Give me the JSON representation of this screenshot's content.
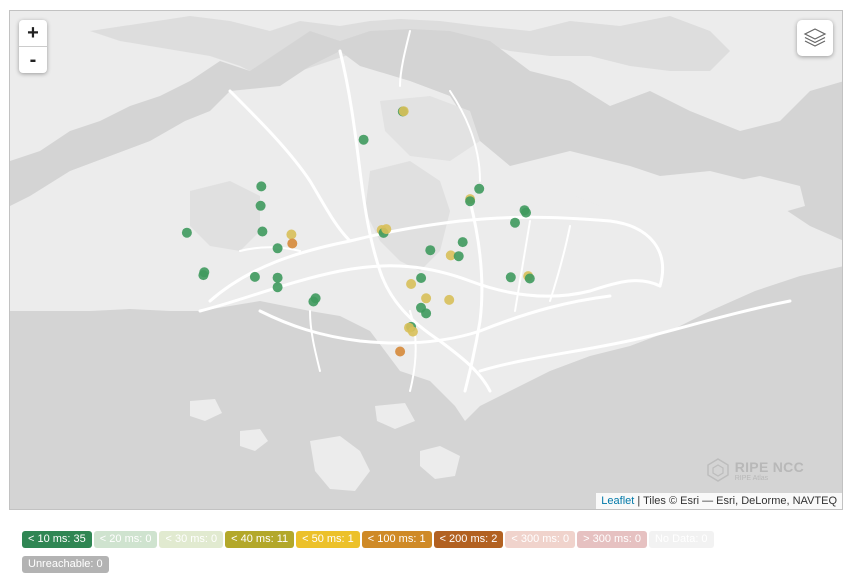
{
  "map": {
    "zoom_in_label": "+",
    "zoom_out_label": "-",
    "layers_icon": "layers-icon",
    "attribution": {
      "link": "Leaflet",
      "text": " | Tiles © Esri — Esri, DeLorme, NAVTEQ"
    },
    "brand": {
      "name": "RIPE NCC",
      "sub": "RIPE Atlas"
    }
  },
  "colors": {
    "water": "#d4d4d4",
    "land": "#ececec",
    "park": "#e2e2e2",
    "road": "#ffffff",
    "green": "#3f9a5e",
    "yellow": "#d8c05a",
    "orange": "#d68a3a"
  },
  "probes": [
    {
      "lat": 1.4487,
      "lon": 103.8213,
      "cat": "green"
    },
    {
      "lat": 1.4309,
      "lon": 103.7999,
      "cat": "green"
    },
    {
      "lat": 1.4489,
      "lon": 103.8218,
      "cat": "yellow"
    },
    {
      "lat": 1.4015,
      "lon": 103.7441,
      "cat": "green"
    },
    {
      "lat": 1.3893,
      "lon": 103.7437,
      "cat": "green"
    },
    {
      "lat": 1.3723,
      "lon": 103.7035,
      "cat": "green"
    },
    {
      "lat": 1.3731,
      "lon": 103.7447,
      "cat": "green"
    },
    {
      "lat": 1.3712,
      "lon": 103.7605,
      "cat": "yellow"
    },
    {
      "lat": 1.3655,
      "lon": 103.761,
      "cat": "orange"
    },
    {
      "lat": 1.3625,
      "lon": 103.753,
      "cat": "green"
    },
    {
      "lat": 1.3474,
      "lon": 103.713,
      "cat": "green"
    },
    {
      "lat": 1.3456,
      "lon": 103.7125,
      "cat": "green"
    },
    {
      "lat": 1.3445,
      "lon": 103.7406,
      "cat": "green"
    },
    {
      "lat": 1.344,
      "lon": 103.753,
      "cat": "green"
    },
    {
      "lat": 1.338,
      "lon": 103.753,
      "cat": "green"
    },
    {
      "lat": 1.331,
      "lon": 103.7737,
      "cat": "green"
    },
    {
      "lat": 1.329,
      "lon": 103.7725,
      "cat": "green"
    },
    {
      "lat": 1.374,
      "lon": 103.8098,
      "cat": "yellow"
    },
    {
      "lat": 1.3722,
      "lon": 103.8108,
      "cat": "green"
    },
    {
      "lat": 1.3746,
      "lon": 103.8123,
      "cat": "yellow"
    },
    {
      "lat": 1.4,
      "lon": 103.863,
      "cat": "green"
    },
    {
      "lat": 1.3935,
      "lon": 103.858,
      "cat": "yellow"
    },
    {
      "lat": 1.3922,
      "lon": 103.858,
      "cat": "green"
    },
    {
      "lat": 1.3664,
      "lon": 103.854,
      "cat": "green"
    },
    {
      "lat": 1.358,
      "lon": 103.8475,
      "cat": "yellow"
    },
    {
      "lat": 1.3575,
      "lon": 103.8518,
      "cat": "green"
    },
    {
      "lat": 1.3613,
      "lon": 103.8363,
      "cat": "green"
    },
    {
      "lat": 1.3438,
      "lon": 103.8313,
      "cat": "green"
    },
    {
      "lat": 1.34,
      "lon": 103.8258,
      "cat": "yellow"
    },
    {
      "lat": 1.331,
      "lon": 103.834,
      "cat": "yellow"
    },
    {
      "lat": 1.33,
      "lon": 103.8466,
      "cat": "yellow"
    },
    {
      "lat": 1.325,
      "lon": 103.8312,
      "cat": "green"
    },
    {
      "lat": 1.3215,
      "lon": 103.834,
      "cat": "green"
    },
    {
      "lat": 1.313,
      "lon": 103.8258,
      "cat": "green"
    },
    {
      "lat": 1.3125,
      "lon": 103.8247,
      "cat": "yellow"
    },
    {
      "lat": 1.31,
      "lon": 103.8268,
      "cat": "yellow"
    },
    {
      "lat": 1.2975,
      "lon": 103.8198,
      "cat": "orange"
    },
    {
      "lat": 1.385,
      "lon": 103.8885,
      "cat": "green"
    },
    {
      "lat": 1.3865,
      "lon": 103.8877,
      "cat": "green"
    },
    {
      "lat": 1.3786,
      "lon": 103.8825,
      "cat": "green"
    },
    {
      "lat": 1.3442,
      "lon": 103.8802,
      "cat": "green"
    },
    {
      "lat": 1.345,
      "lon": 103.8897,
      "cat": "yellow"
    },
    {
      "lat": 1.3435,
      "lon": 103.8906,
      "cat": "green"
    }
  ],
  "legend": [
    {
      "label": "< 10 ms: 35",
      "bg": "#2f8653",
      "fg": "#ffffff"
    },
    {
      "label": "< 20 ms: 0",
      "bg": "#cfe3cf",
      "fg": "#ffffff"
    },
    {
      "label": "< 30 ms: 0",
      "bg": "#e1ead0",
      "fg": "#ffffff"
    },
    {
      "label": "< 40 ms: 11",
      "bg": "#b3a82a",
      "fg": "#ffffff"
    },
    {
      "label": "< 50 ms: 1",
      "bg": "#ecc12a",
      "fg": "#ffffff"
    },
    {
      "label": "< 100 ms: 1",
      "bg": "#cf8a27",
      "fg": "#ffffff"
    },
    {
      "label": "< 200 ms: 2",
      "bg": "#b26121",
      "fg": "#ffffff"
    },
    {
      "label": "< 300 ms: 0",
      "bg": "#f0d3cc",
      "fg": "#ffffff"
    },
    {
      "label": "> 300 ms: 0",
      "bg": "#e6c1c1",
      "fg": "#ffffff"
    },
    {
      "label": "No Data: 0",
      "bg": "#f2f2f2",
      "fg": "#ffffff"
    },
    {
      "label": "Unreachable: 0",
      "bg": "#b3b3b3",
      "fg": "#ffffff"
    }
  ]
}
